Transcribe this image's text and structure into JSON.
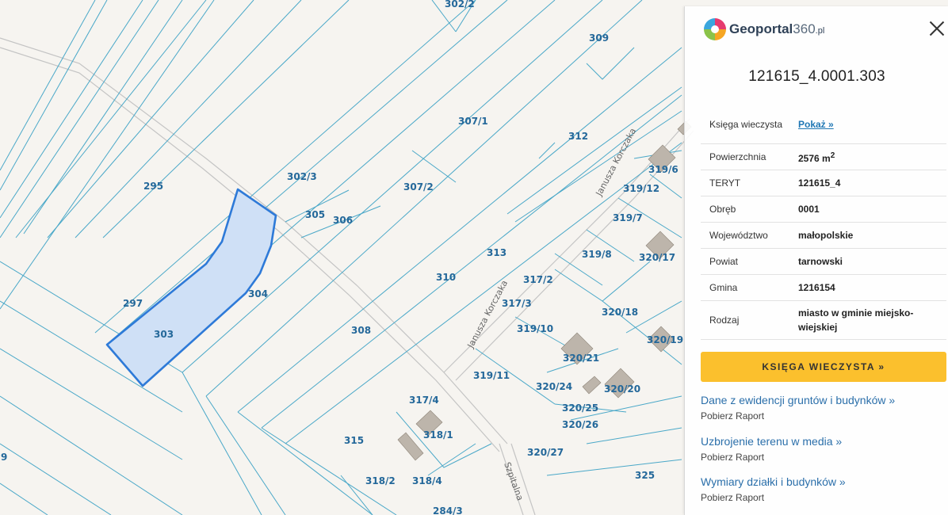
{
  "map": {
    "parcel_labels": [
      {
        "id": "lbl-302-2",
        "text": "302/2"
      },
      {
        "id": "lbl-309",
        "text": "309"
      },
      {
        "id": "lbl-307-1",
        "text": "307/1"
      },
      {
        "id": "lbl-312",
        "text": "312"
      },
      {
        "id": "lbl-295",
        "text": "295"
      },
      {
        "id": "lbl-302-3",
        "text": "302/3"
      },
      {
        "id": "lbl-307-2",
        "text": "307/2"
      },
      {
        "id": "lbl-305",
        "text": "305"
      },
      {
        "id": "lbl-306",
        "text": "306"
      },
      {
        "id": "lbl-313",
        "text": "313"
      },
      {
        "id": "lbl-310",
        "text": "310"
      },
      {
        "id": "lbl-297",
        "text": "297"
      },
      {
        "id": "lbl-304",
        "text": "304"
      },
      {
        "id": "lbl-303",
        "text": "303"
      },
      {
        "id": "lbl-308",
        "text": "308"
      },
      {
        "id": "lbl-317-2",
        "text": "317/2"
      },
      {
        "id": "lbl-317-3",
        "text": "317/3"
      },
      {
        "id": "lbl-319-10",
        "text": "319/10"
      },
      {
        "id": "lbl-319-11",
        "text": "319/11"
      },
      {
        "id": "lbl-320-21",
        "text": "320/21"
      },
      {
        "id": "lbl-320-24",
        "text": "320/24"
      },
      {
        "id": "lbl-320-20",
        "text": "320/20"
      },
      {
        "id": "lbl-320-25",
        "text": "320/25"
      },
      {
        "id": "lbl-320-26",
        "text": "320/26"
      },
      {
        "id": "lbl-320-27",
        "text": "320/27"
      },
      {
        "id": "lbl-317-4",
        "text": "317/4"
      },
      {
        "id": "lbl-318-1",
        "text": "318/1"
      },
      {
        "id": "lbl-315",
        "text": "315"
      },
      {
        "id": "lbl-318-2",
        "text": "318/2"
      },
      {
        "id": "lbl-318-4",
        "text": "318/4"
      },
      {
        "id": "lbl-284-3",
        "text": "284/3"
      },
      {
        "id": "lbl-325",
        "text": "325"
      },
      {
        "id": "lbl-319-6",
        "text": "319/6"
      },
      {
        "id": "lbl-319-12",
        "text": "319/12"
      },
      {
        "id": "lbl-319-7",
        "text": "319/7"
      },
      {
        "id": "lbl-319-8",
        "text": "319/8"
      },
      {
        "id": "lbl-320-17",
        "text": "320/17"
      },
      {
        "id": "lbl-320-18",
        "text": "320/18"
      },
      {
        "id": "lbl-320-19",
        "text": "320/19"
      },
      {
        "id": "lbl-9",
        "text": "9"
      }
    ],
    "street_labels": [
      {
        "id": "street-korczaka",
        "text": "Janusza Korczaka"
      },
      {
        "id": "street-korczaka-2",
        "text": "Janusza Korczaka"
      },
      {
        "id": "street-szpitalna",
        "text": "Szpitalna"
      }
    ],
    "selected_parcel": "303"
  },
  "panel": {
    "logo": {
      "brand": "Geoportal",
      "number": "360",
      "domain": ".pl"
    },
    "parcel_id": "121615_4.0001.303",
    "attributes": [
      {
        "label": "Księga wieczysta",
        "value": "Pokaż »",
        "is_link": true
      },
      {
        "label": "Powierzchnia",
        "value": "2576 m",
        "superscript": "2"
      },
      {
        "label": "TERYT",
        "value": "121615_4"
      },
      {
        "label": "Obręb",
        "value": "0001"
      },
      {
        "label": "Województwo",
        "value": "małopolskie"
      },
      {
        "label": "Powiat",
        "value": "tarnowski"
      },
      {
        "label": "Gmina",
        "value": "1216154"
      },
      {
        "label": "Rodzaj",
        "value": "miasto w gminie miejsko-wiejskiej"
      }
    ],
    "kw_button": "KSIĘGA WIECZYSTA »",
    "reports": [
      {
        "title": "Dane z ewidencji gruntów i budynków »",
        "sub": "Pobierz Raport"
      },
      {
        "title": "Uzbrojenie terenu w media »",
        "sub": "Pobierz Raport"
      },
      {
        "title": "Wymiary działki i budynków »",
        "sub": "Pobierz Raport"
      }
    ]
  },
  "colors": {
    "parcel_line": "#4aa8c8",
    "selected_fill": "#cfe0f6",
    "selected_stroke": "#2e7ad8",
    "label": "#24689a",
    "button": "#fbc02d",
    "link": "#2b6faa"
  }
}
